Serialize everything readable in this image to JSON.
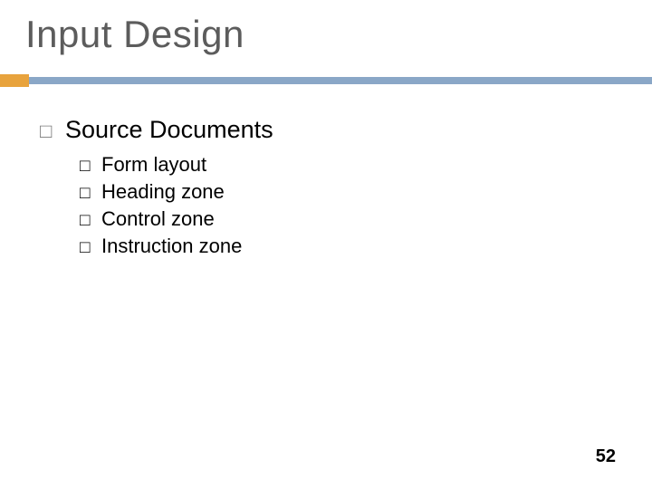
{
  "title": "Input Design",
  "section": {
    "heading": "Source Documents",
    "items": [
      "Form layout",
      "Heading zone",
      "Control zone",
      "Instruction zone"
    ]
  },
  "pageNumber": "52",
  "bullets": {
    "level1": "□",
    "level2": "□"
  }
}
